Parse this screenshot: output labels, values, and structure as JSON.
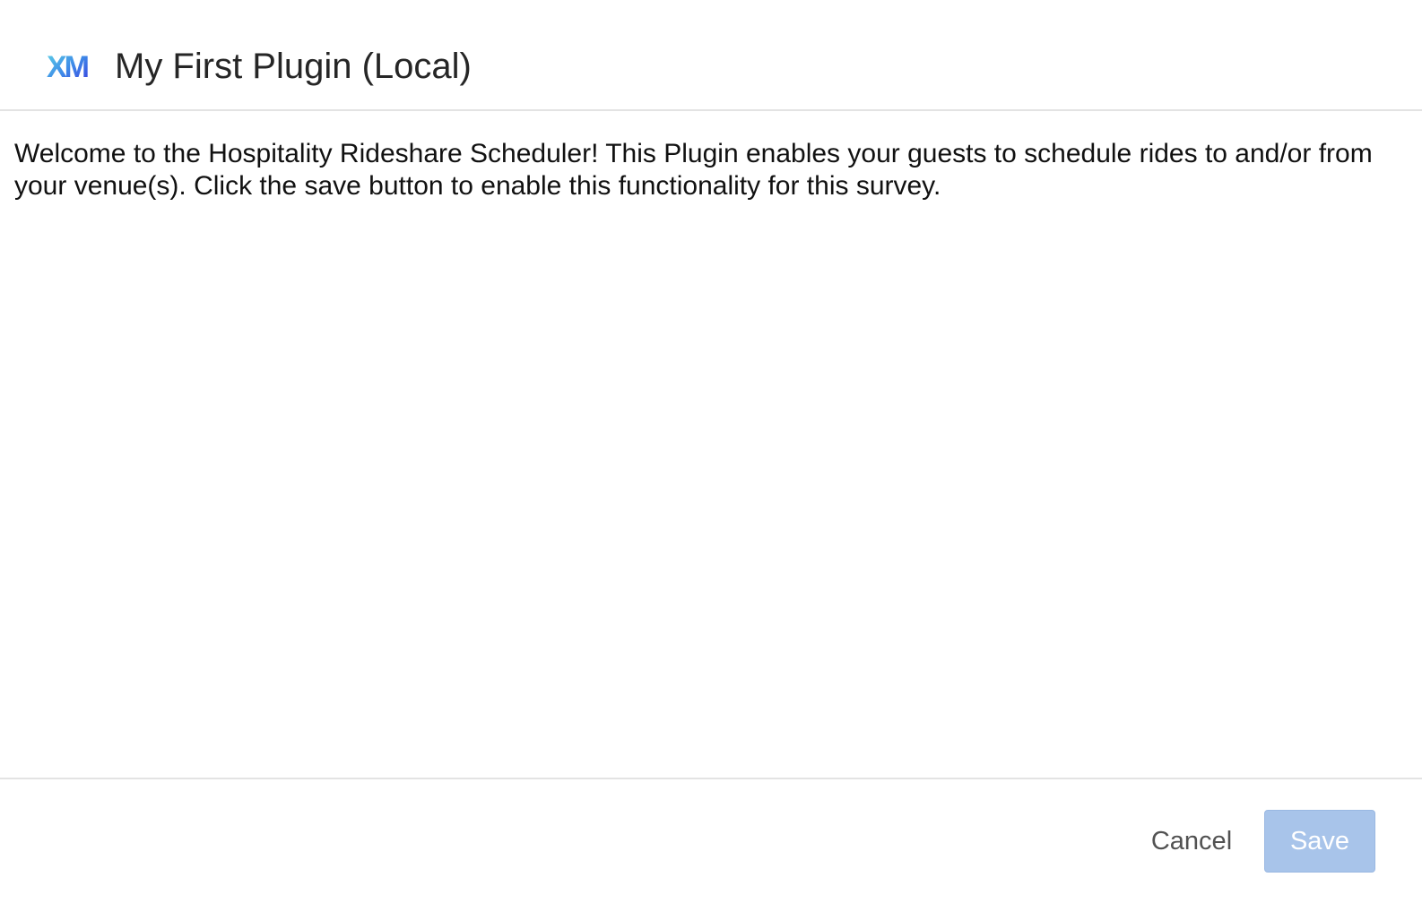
{
  "header": {
    "logo_text": "XM",
    "title": "My First Plugin (Local)"
  },
  "body": {
    "description": "Welcome to the Hospitality Rideshare Scheduler! This Plugin enables your guests to schedule rides to and/or from your venue(s). Click the save button to enable this functionality for this survey."
  },
  "footer": {
    "cancel_label": "Cancel",
    "save_label": "Save",
    "save_disabled": true
  },
  "colors": {
    "save_button_disabled": "#a8c4ea",
    "logo_gradient_start": "#5fd0e0",
    "logo_gradient_end": "#3a3fe0",
    "divider": "#e3e3e3"
  },
  "icons": {
    "logo": "qualtrics-xm-logo"
  }
}
